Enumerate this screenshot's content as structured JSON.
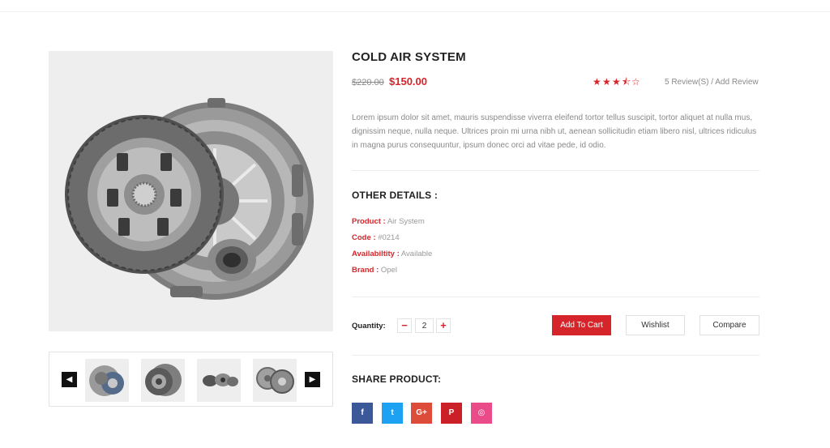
{
  "product": {
    "title": "COLD AIR SYSTEM",
    "old_price": "$220.00",
    "new_price": "$150.00",
    "rating": 3.5,
    "rating_max": 5,
    "reviews_link": "5 Review(S)",
    "reviews_separator": " / ",
    "add_review_link": "Add Review",
    "description": "Lorem ipsum dolor sit amet, mauris suspendisse viverra eleifend tortor tellus suscipit, tortor aliquet at nulla mus, dignissim neque, nulla neque. Ultrices proin mi urna nibh ut, aenean sollicitudin etiam libero nisl, ultrices ridiculus in magna purus consequuntur, ipsum donec orci ad vitae pede, id odio."
  },
  "details": {
    "title": "OTHER DETAILS :",
    "items": [
      {
        "key": "Product :",
        "value": " Air System"
      },
      {
        "key": "Code :",
        "value": " #0214"
      },
      {
        "key": "Availabiltity :",
        "value": " Available"
      },
      {
        "key": "Brand :",
        "value": " Opel"
      }
    ]
  },
  "purchase": {
    "quantity_label": "Quantity:",
    "minus_label": "−",
    "plus_label": "+",
    "quantity_value": "2",
    "add_to_cart": "Add To Cart",
    "wishlist": "Wishlist",
    "compare": "Compare"
  },
  "share": {
    "title": "SHARE PRODUCT:",
    "buttons": [
      {
        "icon": "facebook-icon",
        "glyph": "f",
        "color": "#3b5998"
      },
      {
        "icon": "twitter-icon",
        "glyph": "t",
        "color": "#1da1f2"
      },
      {
        "icon": "google-plus-icon",
        "glyph": "G+",
        "color": "#dd4b39"
      },
      {
        "icon": "pinterest-icon",
        "glyph": "P",
        "color": "#cb2027"
      },
      {
        "icon": "dribbble-icon",
        "glyph": "◎",
        "color": "#ea4c89"
      }
    ]
  },
  "gallery": {
    "prev_glyph": "◀",
    "next_glyph": "▶",
    "thumbnail_count": 4
  },
  "colors": {
    "accent": "#d6252a",
    "muted_text": "#8a8a8a",
    "image_bg": "#eeeeee"
  }
}
